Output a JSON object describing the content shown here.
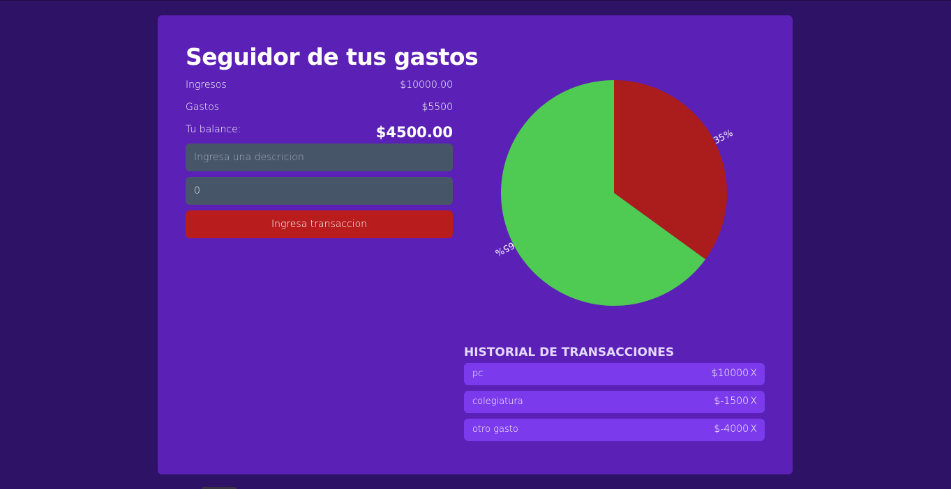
{
  "app": {
    "title": "Seguidor de tus gastos"
  },
  "summary": {
    "income_label": "Ingresos",
    "income_value": "$10000.00",
    "expenses_label": "Gastos",
    "expenses_value": "$5500",
    "balance_label": "Tu balance:",
    "balance_value": "$4500.00"
  },
  "form": {
    "description_placeholder": "Ingresa una descricion",
    "amount_value": "0",
    "submit_label": "Ingresa transaccion"
  },
  "chart_data": {
    "type": "pie",
    "slices": [
      {
        "label": "35%",
        "value": 35,
        "color": "#ab1c1c"
      },
      {
        "label": "65%",
        "value": 65,
        "color": "#4fca52"
      }
    ]
  },
  "history": {
    "title": "HISTORIAL DE TRANSACCIONES",
    "items": [
      {
        "description": "pc",
        "amount": "$10000",
        "delete": "X"
      },
      {
        "description": "colegiatura",
        "amount": "$-1500",
        "delete": "X"
      },
      {
        "description": "otro gasto",
        "amount": "$-4000",
        "delete": "X"
      }
    ]
  },
  "colors": {
    "page_bg": "#2d1266",
    "card_bg": "#5b21b6",
    "input_bg": "#475569",
    "button_bg": "#b91c1c",
    "history_item_bg": "#7c3aed"
  }
}
